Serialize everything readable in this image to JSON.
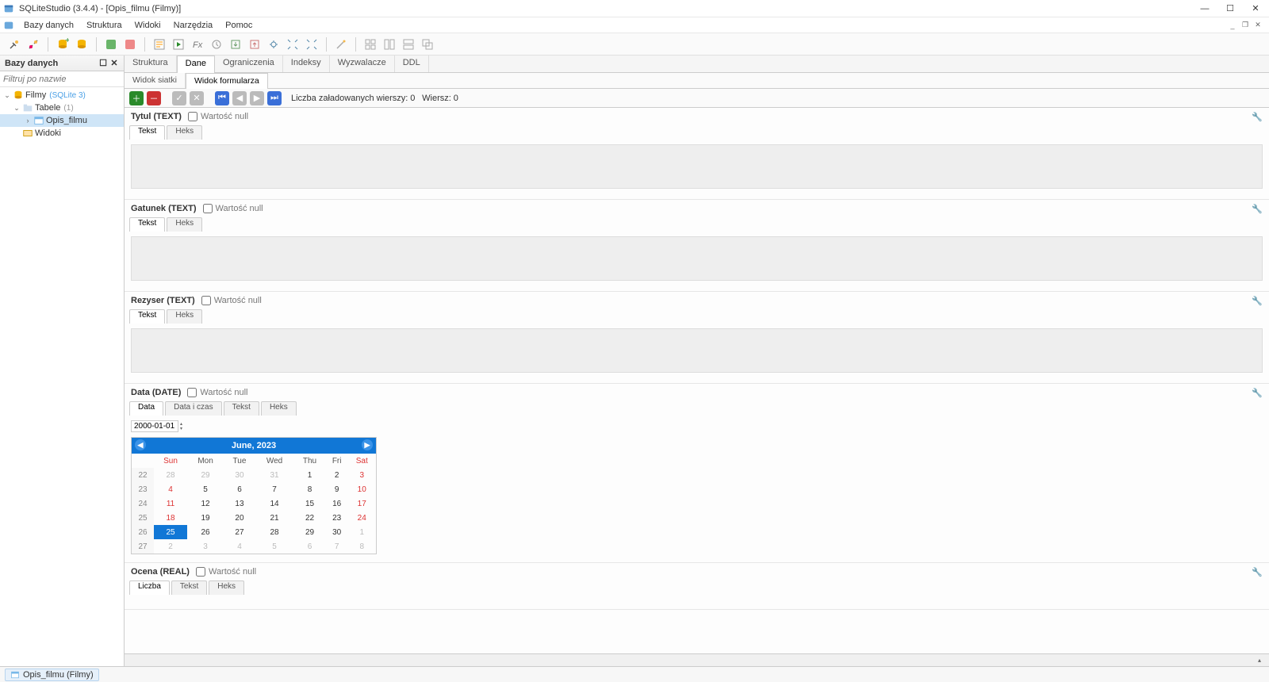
{
  "window": {
    "title": "SQLiteStudio (3.4.4) - [Opis_filmu (Filmy)]"
  },
  "menu": {
    "items": [
      "Bazy danych",
      "Struktura",
      "Widoki",
      "Narzędzia",
      "Pomoc"
    ]
  },
  "sidebar": {
    "title": "Bazy danych",
    "filter_placeholder": "Filtruj po nazwie",
    "tree": {
      "db": "Filmy",
      "db_engine": "(SQLite 3)",
      "tables_label": "Tabele",
      "tables_count": "(1)",
      "table_name": "Opis_filmu",
      "views_label": "Widoki"
    }
  },
  "maintabs": [
    "Struktura",
    "Dane",
    "Ograniczenia",
    "Indeksy",
    "Wyzwalacze",
    "DDL"
  ],
  "maintabs_active": 1,
  "subtabs": [
    "Widok siatki",
    "Widok formularza"
  ],
  "subtabs_active": 1,
  "cmdbar": {
    "loaded_label": "Liczba załadowanych wierszy:",
    "loaded_value": "0",
    "row_label": "Wiersz:",
    "row_value": "0"
  },
  "null_label": "Wartość null",
  "fields": [
    {
      "name": "Tytul (TEXT)",
      "tabs": [
        "Tekst",
        "Heks"
      ],
      "active": 0,
      "body": "textarea"
    },
    {
      "name": "Gatunek (TEXT)",
      "tabs": [
        "Tekst",
        "Heks"
      ],
      "active": 0,
      "body": "textarea"
    },
    {
      "name": "Rezyser (TEXT)",
      "tabs": [
        "Tekst",
        "Heks"
      ],
      "active": 0,
      "body": "textarea"
    },
    {
      "name": "Data (DATE)",
      "tabs": [
        "Data",
        "Data i czas",
        "Tekst",
        "Heks"
      ],
      "active": 0,
      "body": "date",
      "date_value": "2000-01-01"
    },
    {
      "name": "Ocena (REAL)",
      "tabs": [
        "Liczba",
        "Tekst",
        "Heks"
      ],
      "active": 0,
      "body": "none"
    }
  ],
  "calendar": {
    "title": "June,   2023",
    "dow": [
      "Sun",
      "Mon",
      "Tue",
      "Wed",
      "Thu",
      "Fri",
      "Sat"
    ],
    "weeks": [
      {
        "wk": 22,
        "days": [
          28,
          29,
          30,
          31,
          1,
          2,
          3
        ],
        "dim": [
          0,
          1,
          2,
          3
        ],
        "we": [
          0,
          6
        ]
      },
      {
        "wk": 23,
        "days": [
          4,
          5,
          6,
          7,
          8,
          9,
          10
        ],
        "dim": [],
        "we": [
          0,
          6
        ]
      },
      {
        "wk": 24,
        "days": [
          11,
          12,
          13,
          14,
          15,
          16,
          17
        ],
        "dim": [],
        "we": [
          0,
          6
        ]
      },
      {
        "wk": 25,
        "days": [
          18,
          19,
          20,
          21,
          22,
          23,
          24
        ],
        "dim": [],
        "we": [
          0,
          6
        ]
      },
      {
        "wk": 26,
        "days": [
          25,
          26,
          27,
          28,
          29,
          30,
          1
        ],
        "dim": [
          6
        ],
        "we": [
          0,
          6
        ],
        "today": 0
      },
      {
        "wk": 27,
        "days": [
          2,
          3,
          4,
          5,
          6,
          7,
          8
        ],
        "dim": [
          0,
          1,
          2,
          3,
          4,
          5,
          6
        ],
        "we": [
          0,
          6
        ]
      }
    ]
  },
  "statusbar": {
    "doc": "Opis_filmu (Filmy)"
  }
}
